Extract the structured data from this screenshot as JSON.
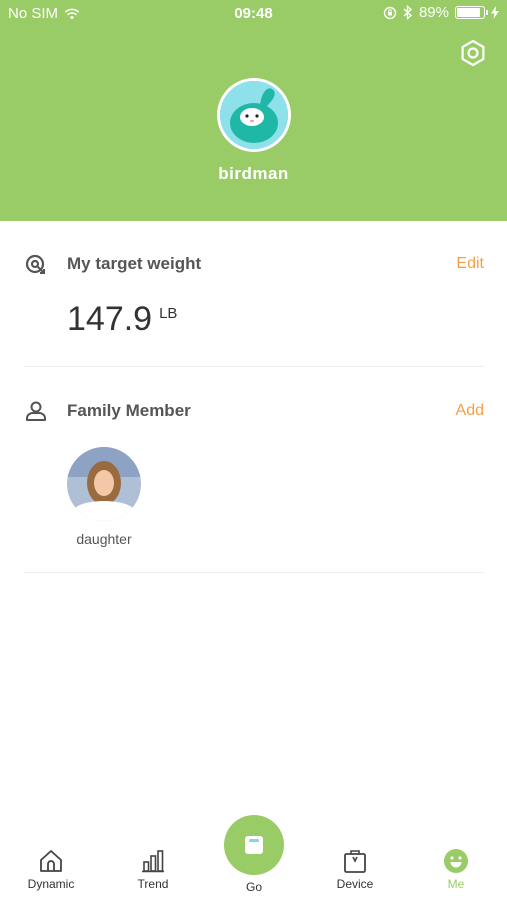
{
  "status_bar": {
    "carrier": "No SIM",
    "time": "09:48",
    "battery": "89%",
    "battery_level": 0.89
  },
  "profile": {
    "username": "birdman",
    "avatar_icon": "bunny-avatar-icon"
  },
  "target_weight": {
    "title": "My target weight",
    "action": "Edit",
    "value": "147.9",
    "unit": "LB"
  },
  "family": {
    "title": "Family Member",
    "action": "Add",
    "members": [
      {
        "name": "daughter"
      }
    ]
  },
  "tabs": [
    {
      "label": "Dynamic",
      "icon": "house-icon"
    },
    {
      "label": "Trend",
      "icon": "bar-chart-icon"
    },
    {
      "label": "Go",
      "icon": "scale-icon"
    },
    {
      "label": "Device",
      "icon": "bag-icon"
    },
    {
      "label": "Me",
      "icon": "smiley-icon",
      "active": true
    }
  ],
  "colors": {
    "brand_green": "#99cc66",
    "accent_orange": "#f5a046",
    "text": "#333333"
  }
}
